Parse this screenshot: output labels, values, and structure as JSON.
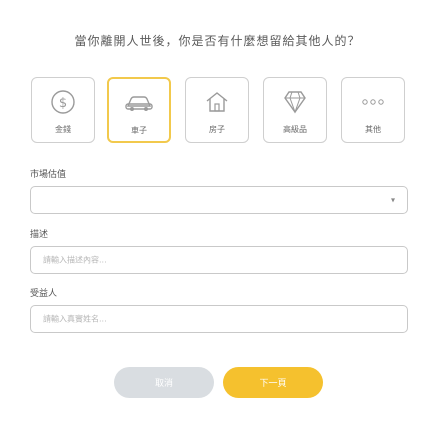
{
  "dialog": {
    "title": "當你離開人世後，你是否有什麼想留給其他人的？"
  },
  "categories": [
    {
      "label": "金錢",
      "icon": "dollar-coin-icon",
      "selected": false
    },
    {
      "label": "車子",
      "icon": "car-icon",
      "selected": true
    },
    {
      "label": "房子",
      "icon": "house-icon",
      "selected": false
    },
    {
      "label": "高級品",
      "icon": "diamond-icon",
      "selected": false
    },
    {
      "label": "其他",
      "icon": "more-dots-icon",
      "selected": false
    }
  ],
  "form": {
    "market_value_label": "市場估值",
    "market_value_value": "",
    "description_label": "描述",
    "description_placeholder": "請輸入描述內容...",
    "beneficiary_label": "受益人",
    "beneficiary_placeholder": "請輸入真實姓名..."
  },
  "actions": {
    "cancel_label": "取消",
    "next_label": "下一頁"
  },
  "colors": {
    "accent": "#f5c12e",
    "selected_border": "#f2c94c",
    "cancel_bg": "#d9dde1",
    "border": "#c9c9c9"
  }
}
